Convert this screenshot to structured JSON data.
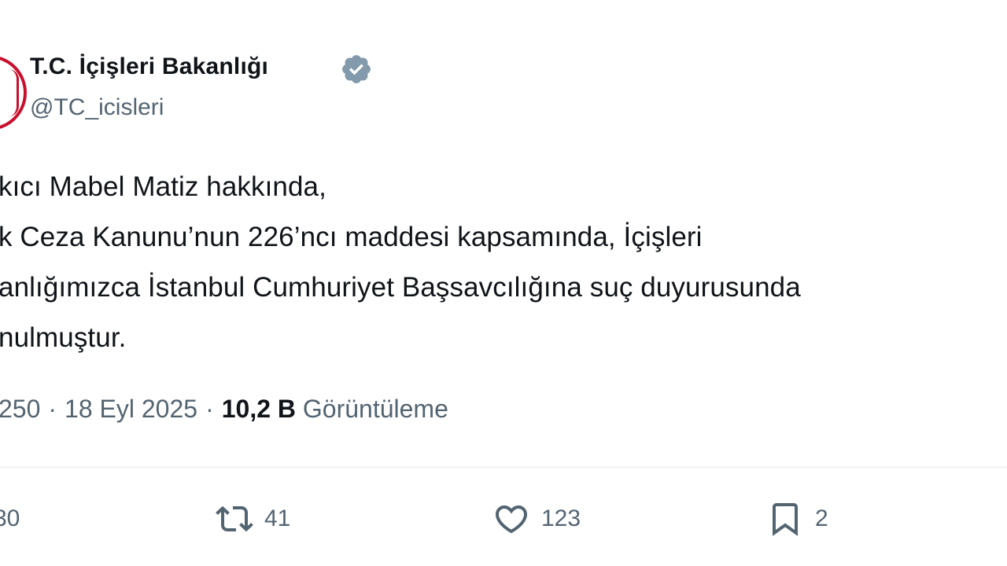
{
  "author": {
    "display_name": "T.C. İçişleri Bakanlığı",
    "handle": "@TC_icisleri",
    "verified_badge": "verified-badge-icon",
    "badge_color": "#829aab"
  },
  "tweet": {
    "lines": [
      "kıcı Mabel Matiz hakkında,",
      "k Ceza Kanunu’nun 226’ncı maddesi kapsamında, İçişleri",
      "anlığımızca İstanbul Cumhuriyet Başsavcılığına suç duyurusunda",
      "nulmuştur."
    ]
  },
  "meta": {
    "time": "250",
    "date": "18 Eyl 2025",
    "separator": "·",
    "views_count": "10,2 B",
    "views_label": "Görüntüleme"
  },
  "actions": {
    "reply_count": "30",
    "retweet_count": "41",
    "like_count": "123",
    "bookmark_count": "2"
  },
  "colors": {
    "text": "#0f1419",
    "secondary": "#536471",
    "avatar_border": "#c8102e"
  }
}
